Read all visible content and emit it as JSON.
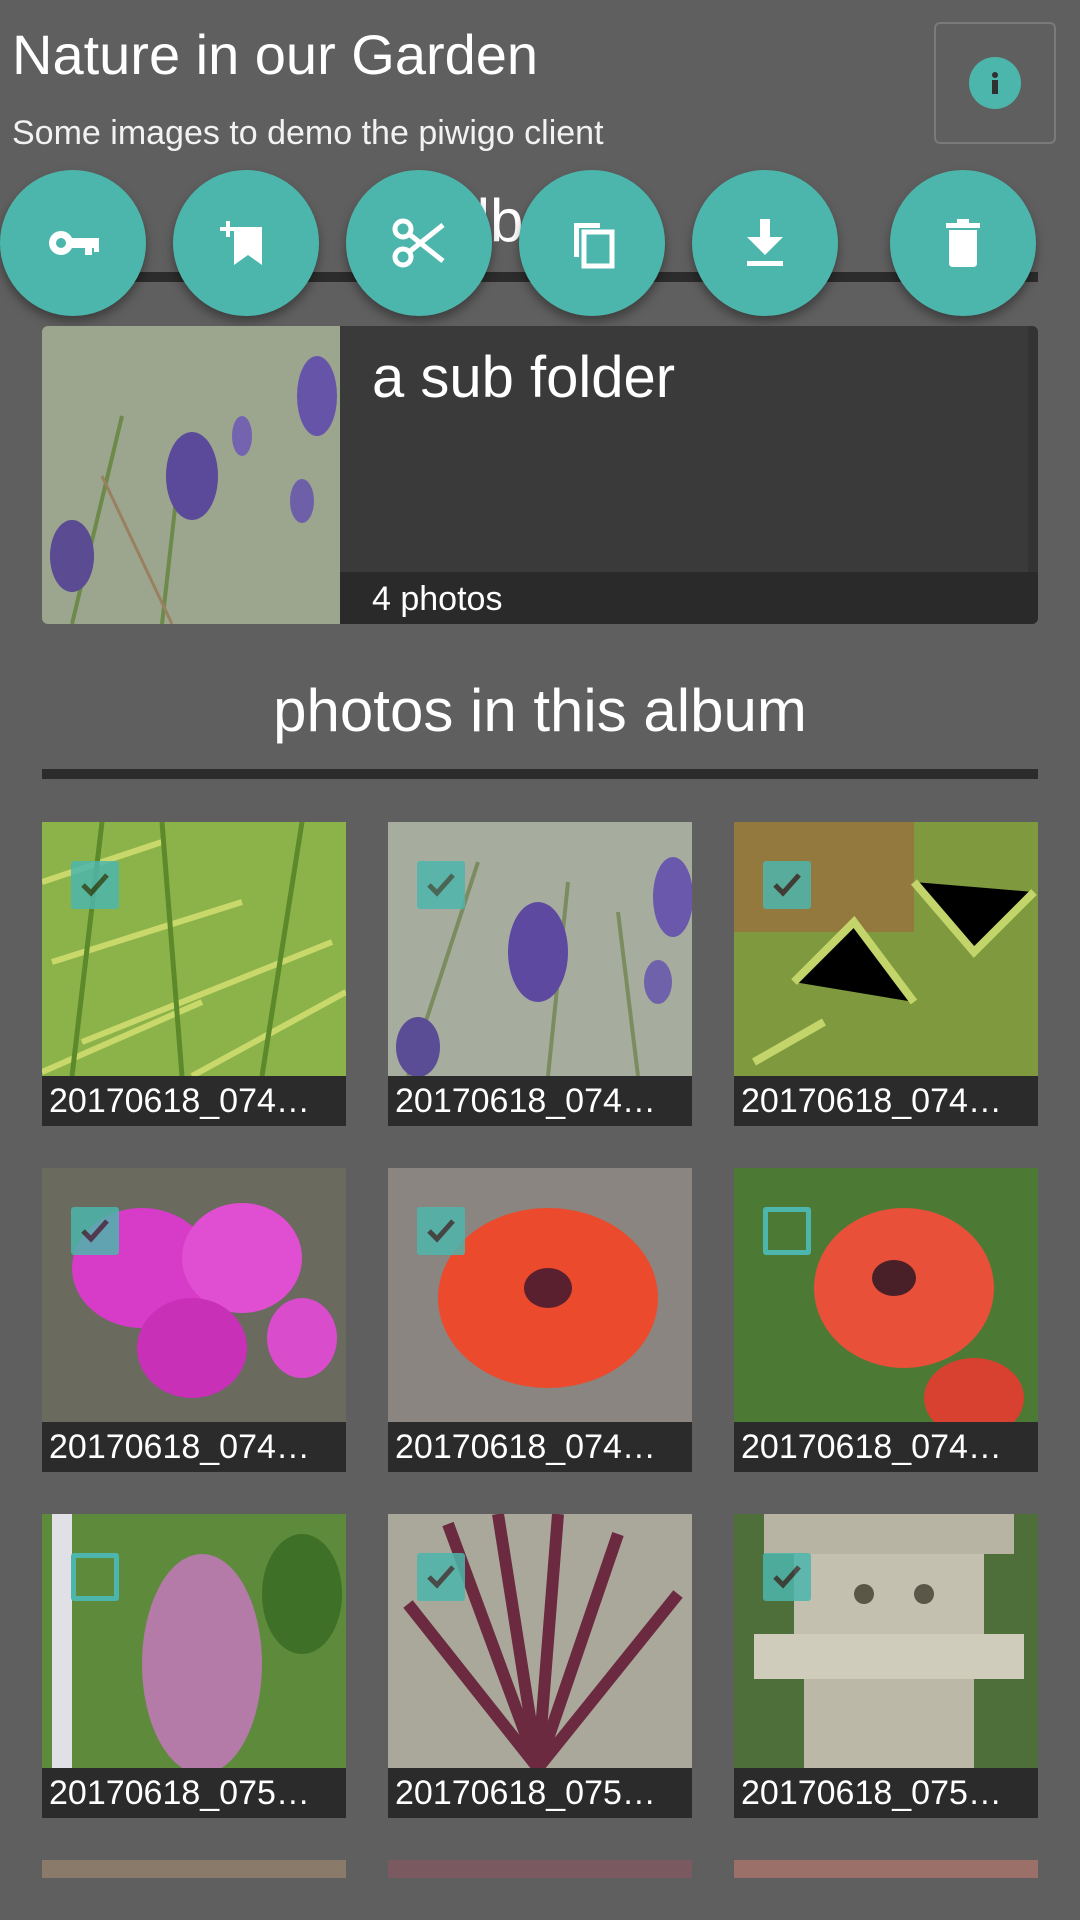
{
  "header": {
    "title": "Nature in our Garden",
    "subtitle": "Some images to demo the piwigo client",
    "info_icon": "info-icon"
  },
  "colors": {
    "accent": "#4db6ac",
    "background": "#5f5f5f",
    "card": "#3a3a3a"
  },
  "actions": [
    {
      "name": "permissions",
      "icon": "key-icon"
    },
    {
      "name": "add-to-album",
      "icon": "bookmark-add-icon"
    },
    {
      "name": "move",
      "icon": "scissors-icon"
    },
    {
      "name": "copy",
      "icon": "copy-icon"
    },
    {
      "name": "download",
      "icon": "download-icon"
    },
    {
      "name": "delete",
      "icon": "trash-icon"
    }
  ],
  "subalbums_heading": "albums",
  "album": {
    "name": "a sub folder",
    "count": "4 photos"
  },
  "photos_heading": "photos in this album",
  "photos": [
    {
      "caption": "20170618_074…",
      "selected": true
    },
    {
      "caption": "20170618_074…",
      "selected": true
    },
    {
      "caption": "20170618_074…",
      "selected": true
    },
    {
      "caption": "20170618_074…",
      "selected": true
    },
    {
      "caption": "20170618_074…",
      "selected": true
    },
    {
      "caption": "20170618_074…",
      "selected": false
    },
    {
      "caption": "20170618_075…",
      "selected": false
    },
    {
      "caption": "20170618_075…",
      "selected": true
    },
    {
      "caption": "20170618_075…",
      "selected": true
    }
  ]
}
